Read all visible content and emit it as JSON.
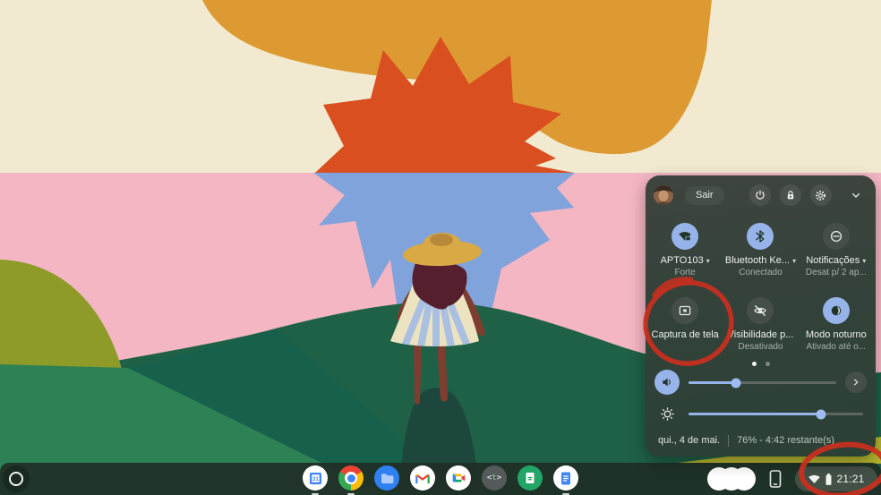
{
  "quick_settings": {
    "sign_out_label": "Sair",
    "header_icons": [
      "power-icon",
      "lock-icon",
      "settings-gear-icon",
      "collapse-chevron-icon"
    ],
    "tiles": [
      {
        "label": "APTO103",
        "sublabel": "Forte",
        "icon": "wifi-lock-icon",
        "active": true,
        "dropdown": true
      },
      {
        "label": "Bluetooth Ke...",
        "sublabel": "Conectado",
        "icon": "bluetooth-icon",
        "active": true,
        "dropdown": true
      },
      {
        "label": "Notificações",
        "sublabel": "Desat p/ 2 ap...",
        "icon": "do-not-disturb-icon",
        "active": false,
        "dropdown": true
      },
      {
        "label": "Captura de tela",
        "sublabel": "",
        "icon": "screen-capture-icon",
        "active": false,
        "dropdown": false
      },
      {
        "label": "Visibilidade p...",
        "sublabel": "Desativado",
        "icon": "visibility-off-icon",
        "active": false,
        "dropdown": false
      },
      {
        "label": "Modo noturno",
        "sublabel": "Ativado até o...",
        "icon": "night-mode-icon",
        "active": true,
        "dropdown": false
      }
    ],
    "pagination": {
      "pages": 2,
      "active_page": 1
    },
    "sliders": {
      "volume_percent": 32,
      "brightness_percent": 76
    },
    "footer": {
      "date": "qui., 4 de mai.",
      "battery_status": "76% - 4:42 restante(s)"
    }
  },
  "shelf": {
    "launcher": "launcher-icon",
    "apps": [
      {
        "name": "google-calendar",
        "running": true
      },
      {
        "name": "google-chrome",
        "running": true
      },
      {
        "name": "files-app",
        "running": false
      },
      {
        "name": "gmail",
        "running": false
      },
      {
        "name": "google-meet",
        "running": false
      },
      {
        "name": "text-editor",
        "running": false
      },
      {
        "name": "google-sheets",
        "running": false
      },
      {
        "name": "google-docs",
        "running": true
      }
    ],
    "tote_items": 3,
    "status_tray": {
      "time": "21:21",
      "icons": [
        "wifi-icon",
        "battery-icon"
      ]
    }
  },
  "annotations": {
    "color": "#c92f1e",
    "shapes": [
      "circle-around-screen-capture-tile",
      "circle-around-status-tray-clock"
    ]
  },
  "colors": {
    "accent_blue": "#96b4ea",
    "panel_bg": "#33423a",
    "shelf_bg": "#1f2e26"
  }
}
